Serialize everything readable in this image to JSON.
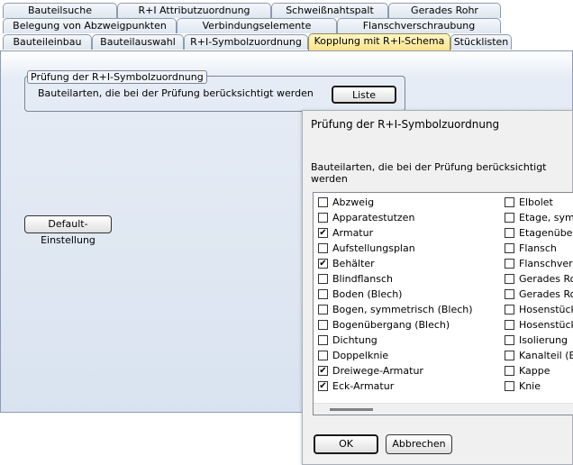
{
  "tabs": {
    "row1": [
      "Bauteilsuche",
      "R+I Attributzuordnung",
      "Schweißnahtspalt",
      "Gerades Rohr"
    ],
    "row2": [
      "Belegung von Abzweigpunkten",
      "Verbindungselemente",
      "Flanschverschraubung"
    ],
    "row3": [
      "Bauteileinbau",
      "Bauteilauswahl",
      "R+I-Symbolzuordnung",
      "Kopplung mit R+I-Schema",
      "Stücklisten"
    ],
    "active": "Kopplung mit R+I-Schema"
  },
  "group": {
    "title": "Prüfung der R+I-Symbolzuordnung",
    "text": "Bauteilarten, die bei der Prüfung berücksichtigt werden",
    "list_button": "Liste"
  },
  "default_button": "Default-Einstellung",
  "dialog": {
    "title": "Prüfung der R+I-Symbolzuordnung",
    "prompt": "Bauteilarten, die bei der Prüfung berücksichtigt werden",
    "ok": "OK",
    "cancel": "Abbrechen",
    "col1": [
      {
        "label": "Abzweig",
        "checked": false
      },
      {
        "label": "Apparatestutzen",
        "checked": false
      },
      {
        "label": "Armatur",
        "checked": true
      },
      {
        "label": "Aufstellungsplan",
        "checked": false
      },
      {
        "label": "Behälter",
        "checked": true
      },
      {
        "label": "Blindflansch",
        "checked": false
      },
      {
        "label": "Boden (Blech)",
        "checked": false
      },
      {
        "label": "Bogen, symmetrisch (Blech)",
        "checked": false
      },
      {
        "label": "Bogenübergang (Blech)",
        "checked": false
      },
      {
        "label": "Dichtung",
        "checked": false
      },
      {
        "label": "Doppelknie",
        "checked": false
      },
      {
        "label": "Dreiwege-Armatur",
        "checked": true
      },
      {
        "label": "Eck-Armatur",
        "checked": true
      }
    ],
    "col2": [
      {
        "label": "Elbolet",
        "checked": false
      },
      {
        "label": "Etage, sym",
        "checked": false
      },
      {
        "label": "Etagenübe",
        "checked": false
      },
      {
        "label": "Flansch",
        "checked": false
      },
      {
        "label": "Flanschver",
        "checked": false
      },
      {
        "label": "Gerades Ro",
        "checked": false
      },
      {
        "label": "Gerades Ro",
        "checked": false
      },
      {
        "label": "Hosenstück",
        "checked": false
      },
      {
        "label": "Hosenstück",
        "checked": false
      },
      {
        "label": "Isolierung",
        "checked": false
      },
      {
        "label": "Kanalteil (E",
        "checked": false
      },
      {
        "label": "Kappe",
        "checked": false
      },
      {
        "label": "Knie",
        "checked": false
      }
    ]
  }
}
